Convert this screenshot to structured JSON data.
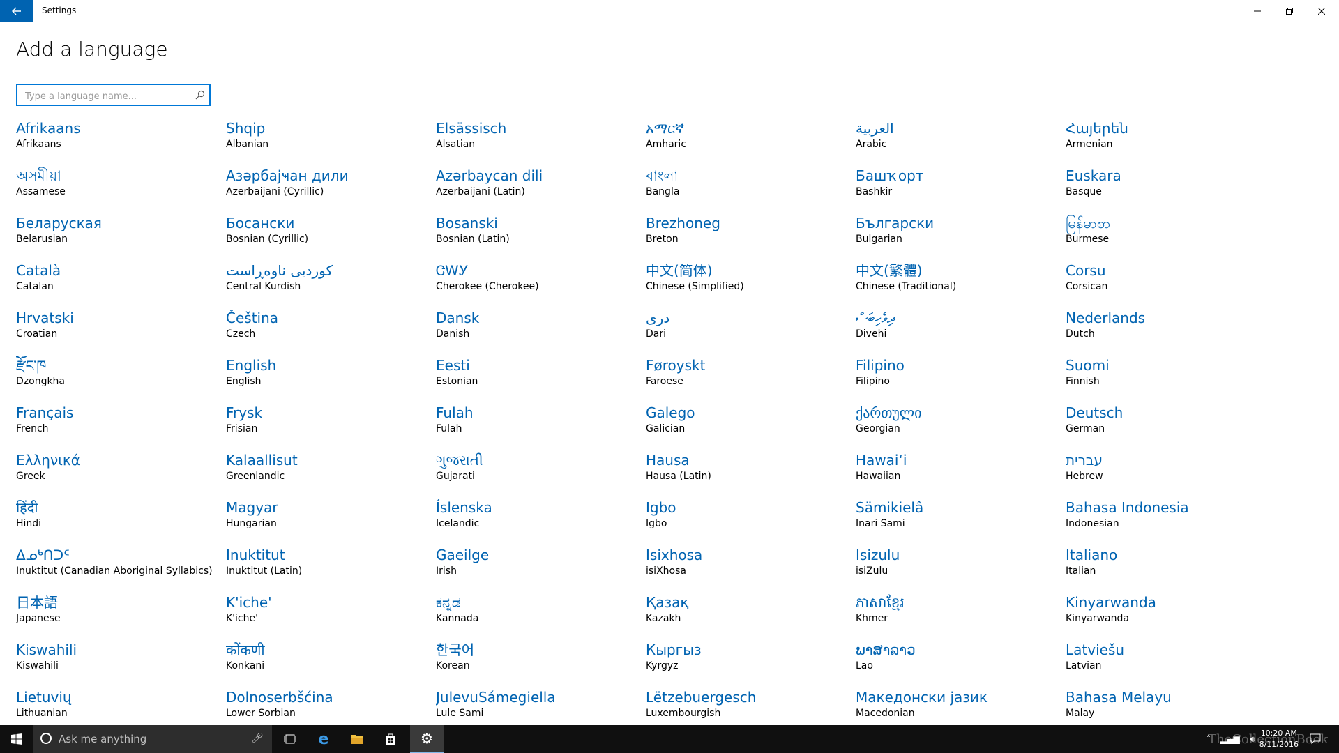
{
  "window": {
    "title": "Settings",
    "back_icon": "back-arrow-icon",
    "controls": {
      "minimize": "—",
      "restore": "❐",
      "close": "✕"
    }
  },
  "page": {
    "title": "Add a language",
    "search": {
      "placeholder": "Type a language name...",
      "value": ""
    }
  },
  "accent_color": "#0063b1",
  "languages": [
    {
      "native": "Afrikaans",
      "english": "Afrikaans"
    },
    {
      "native": "Shqip",
      "english": "Albanian"
    },
    {
      "native": "Elsässisch",
      "english": "Alsatian"
    },
    {
      "native": "አማርኛ",
      "english": "Amharic"
    },
    {
      "native": "العربية",
      "english": "Arabic"
    },
    {
      "native": "Հայերեն",
      "english": "Armenian"
    },
    {
      "native": "অসমীয়া",
      "english": "Assamese"
    },
    {
      "native": "Азәрбајҹан дили",
      "english": "Azerbaijani (Cyrillic)"
    },
    {
      "native": "Azərbaycan dili",
      "english": "Azerbaijani (Latin)"
    },
    {
      "native": "বাংলা",
      "english": "Bangla"
    },
    {
      "native": "Башҡорт",
      "english": "Bashkir"
    },
    {
      "native": "Euskara",
      "english": "Basque"
    },
    {
      "native": "Беларуская",
      "english": "Belarusian"
    },
    {
      "native": "Босански",
      "english": "Bosnian (Cyrillic)"
    },
    {
      "native": "Bosanski",
      "english": "Bosnian (Latin)"
    },
    {
      "native": "Brezhoneg",
      "english": "Breton"
    },
    {
      "native": "Български",
      "english": "Bulgarian"
    },
    {
      "native": "မြန်မာစာ",
      "english": "Burmese"
    },
    {
      "native": "Català",
      "english": "Catalan"
    },
    {
      "native": "کوردیی ناوەڕاست",
      "english": "Central Kurdish"
    },
    {
      "native": "ᏣᎳᎩ",
      "english": "Cherokee (Cherokee)"
    },
    {
      "native": "中文(简体)",
      "english": "Chinese (Simplified)"
    },
    {
      "native": "中文(繁體)",
      "english": "Chinese (Traditional)"
    },
    {
      "native": "Corsu",
      "english": "Corsican"
    },
    {
      "native": "Hrvatski",
      "english": "Croatian"
    },
    {
      "native": "Čeština",
      "english": "Czech"
    },
    {
      "native": "Dansk",
      "english": "Danish"
    },
    {
      "native": "دری",
      "english": "Dari"
    },
    {
      "native": "ދިވެހިބަސް",
      "english": "Divehi"
    },
    {
      "native": "Nederlands",
      "english": "Dutch"
    },
    {
      "native": "རྫོང་ཁ",
      "english": "Dzongkha"
    },
    {
      "native": "English",
      "english": "English"
    },
    {
      "native": "Eesti",
      "english": "Estonian"
    },
    {
      "native": "Føroyskt",
      "english": "Faroese"
    },
    {
      "native": "Filipino",
      "english": "Filipino"
    },
    {
      "native": "Suomi",
      "english": "Finnish"
    },
    {
      "native": "Français",
      "english": "French"
    },
    {
      "native": "Frysk",
      "english": "Frisian"
    },
    {
      "native": "Fulah",
      "english": "Fulah"
    },
    {
      "native": "Galego",
      "english": "Galician"
    },
    {
      "native": "ქართული",
      "english": "Georgian"
    },
    {
      "native": "Deutsch",
      "english": "German"
    },
    {
      "native": "Ελληνικά",
      "english": "Greek"
    },
    {
      "native": "Kalaallisut",
      "english": "Greenlandic"
    },
    {
      "native": "ગુજરાતી",
      "english": "Gujarati"
    },
    {
      "native": "Hausa",
      "english": "Hausa (Latin)"
    },
    {
      "native": "Hawaiʻi",
      "english": "Hawaiian"
    },
    {
      "native": "עברית",
      "english": "Hebrew"
    },
    {
      "native": "हिंदी",
      "english": "Hindi"
    },
    {
      "native": "Magyar",
      "english": "Hungarian"
    },
    {
      "native": "Íslenska",
      "english": "Icelandic"
    },
    {
      "native": "Igbo",
      "english": "Igbo"
    },
    {
      "native": "Sämikielâ",
      "english": "Inari Sami"
    },
    {
      "native": "Bahasa Indonesia",
      "english": "Indonesian"
    },
    {
      "native": "ᐃᓄᒃᑎᑐᑦ",
      "english": "Inuktitut (Canadian Aboriginal Syllabics)"
    },
    {
      "native": "Inuktitut",
      "english": "Inuktitut (Latin)"
    },
    {
      "native": "Gaeilge",
      "english": "Irish"
    },
    {
      "native": "Isixhosa",
      "english": "isiXhosa"
    },
    {
      "native": "Isizulu",
      "english": "isiZulu"
    },
    {
      "native": "Italiano",
      "english": "Italian"
    },
    {
      "native": "日本語",
      "english": "Japanese"
    },
    {
      "native": "K'iche'",
      "english": "K'iche'"
    },
    {
      "native": "ಕನ್ನಡ",
      "english": "Kannada"
    },
    {
      "native": "Қазақ",
      "english": "Kazakh"
    },
    {
      "native": "ភាសាខ្មែរ",
      "english": "Khmer"
    },
    {
      "native": "Kinyarwanda",
      "english": "Kinyarwanda"
    },
    {
      "native": "Kiswahili",
      "english": "Kiswahili"
    },
    {
      "native": "कोंकणी",
      "english": "Konkani"
    },
    {
      "native": "한국어",
      "english": "Korean"
    },
    {
      "native": "Кыргыз",
      "english": "Kyrgyz"
    },
    {
      "native": "ພາສາລາວ",
      "english": "Lao"
    },
    {
      "native": "Latviešu",
      "english": "Latvian"
    },
    {
      "native": "Lietuvių",
      "english": "Lithuanian"
    },
    {
      "native": "Dolnoserbšćina",
      "english": "Lower Sorbian"
    },
    {
      "native": "JulevuSámegiella",
      "english": "Lule Sami"
    },
    {
      "native": "Lëtzebuergesch",
      "english": "Luxembourgish"
    },
    {
      "native": "Македонски јазик",
      "english": "Macedonian"
    },
    {
      "native": "Bahasa Melayu",
      "english": "Malay"
    }
  ],
  "taskbar": {
    "search_placeholder": "Ask me anything",
    "start_icon": "windows-logo-icon",
    "apps": [
      "task-view-icon",
      "edge-icon",
      "file-explorer-icon",
      "store-icon",
      "settings-gear-icon"
    ],
    "time": "10:20 AM",
    "date": "8/11/2016",
    "watermark": "TheCollectionBook"
  }
}
